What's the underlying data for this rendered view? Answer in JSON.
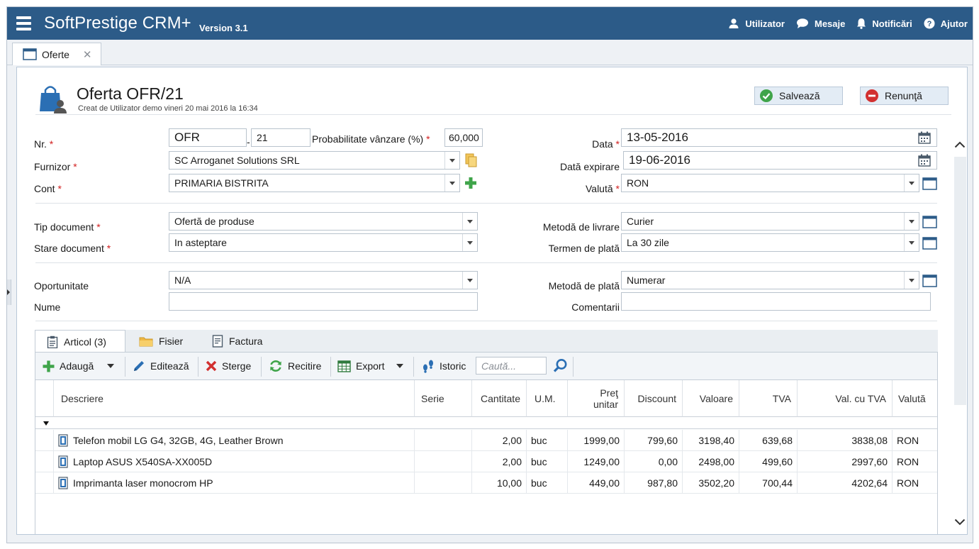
{
  "app": {
    "title": "SoftPrestige CRM+",
    "version": "Version 3.1",
    "menu": {
      "user": "Utilizator",
      "messages": "Mesaje",
      "notifications": "Notificări",
      "help": "Ajutor"
    }
  },
  "doc_tab": {
    "label": "Oferte",
    "close": "✕"
  },
  "header": {
    "title": "Oferta OFR/21",
    "subtitle": "Creat de Utilizator demo vineri 20 mai 2016 la 16:34",
    "save_label": "Salvează",
    "cancel_label": "Renunţă"
  },
  "form": {
    "nr": {
      "label": "Nr.",
      "prefix": "OFR",
      "number": "21"
    },
    "probability": {
      "label": "Probabilitate vânzare (%)",
      "value": "60,000"
    },
    "supplier": {
      "label": "Furnizor",
      "value": "SC Arroganet Solutions SRL"
    },
    "account": {
      "label": "Cont",
      "value": "PRIMARIA BISTRITA"
    },
    "date": {
      "label": "Data",
      "value": "13-05-2016"
    },
    "expiry": {
      "label": "Dată expirare",
      "value": "19-06-2016"
    },
    "currency": {
      "label": "Valută",
      "value": "RON"
    },
    "doc_type": {
      "label": "Tip document",
      "value": "Ofertă de produse"
    },
    "doc_state": {
      "label": "Stare document",
      "value": "In asteptare"
    },
    "delivery": {
      "label": "Metodă de livrare",
      "value": "Curier"
    },
    "payment_term": {
      "label": "Termen de plată",
      "value": "La 30 zile"
    },
    "opportunity": {
      "label": "Oportunitate",
      "value": "N/A"
    },
    "name": {
      "label": "Nume",
      "value": ""
    },
    "payment_method": {
      "label": "Metodă de plată",
      "value": "Numerar"
    },
    "comments": {
      "label": "Comentarii",
      "value": ""
    },
    "required_mark": "*"
  },
  "subtabs": [
    {
      "label": "Articol (3)"
    },
    {
      "label": "Fisier"
    },
    {
      "label": "Factura"
    }
  ],
  "toolbar": {
    "add": "Adaugă",
    "edit": "Editează",
    "delete": "Sterge",
    "reload": "Recitire",
    "export": "Export",
    "history": "Istoric",
    "search_placeholder": "Caută..."
  },
  "grid": {
    "columns": [
      "Descriere",
      "Serie",
      "Cantitate",
      "U.M.",
      "Preţ unitar",
      "Discount",
      "Valoare",
      "TVA",
      "Val. cu TVA",
      "Valută"
    ],
    "rows": [
      [
        "Telefon mobil LG G4, 32GB, 4G, Leather Brown",
        "",
        "2,00",
        "buc",
        "1999,00",
        "799,60",
        "3198,40",
        "639,68",
        "3838,08",
        "RON"
      ],
      [
        "Laptop ASUS X540SA-XX005D",
        "",
        "2,00",
        "buc",
        "1249,00",
        "0,00",
        "2498,00",
        "499,60",
        "2997,60",
        "RON"
      ],
      [
        "Imprimanta laser monocrom HP",
        "",
        "10,00",
        "buc",
        "449,00",
        "987,80",
        "3502,20",
        "700,44",
        "4202,64",
        "RON"
      ]
    ]
  },
  "colors": {
    "topbar": "#2c5b88",
    "required": "#d21f1f",
    "add_green": "#3fa44a",
    "delete_red": "#d23030"
  }
}
